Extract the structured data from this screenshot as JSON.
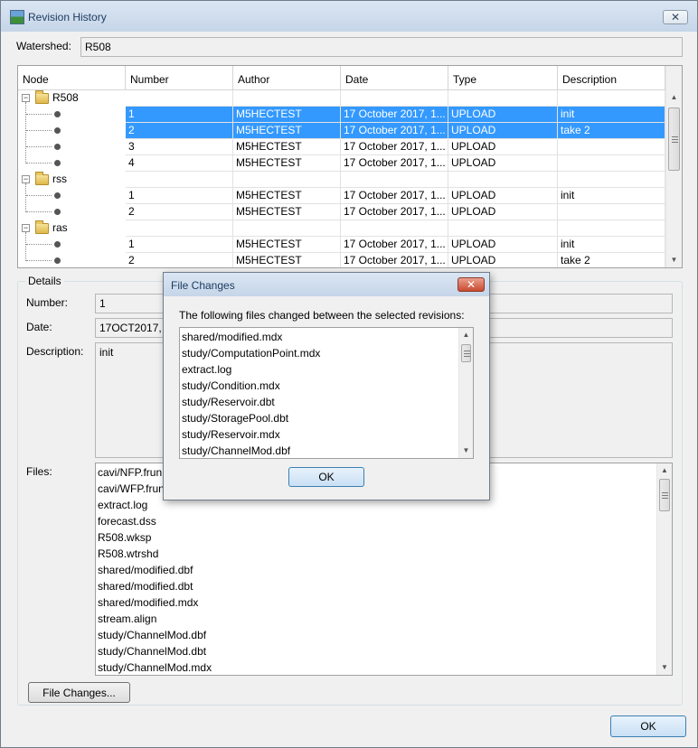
{
  "window": {
    "title": "Revision History",
    "close_symbol": "✕"
  },
  "watershed": {
    "label": "Watershed:",
    "value": "R508"
  },
  "table": {
    "columns": [
      "Node",
      "Number",
      "Author",
      "Date",
      "Type",
      "Description"
    ],
    "groups": [
      {
        "name": "R508",
        "expander": "−",
        "rows": [
          {
            "number": "1",
            "author": "M5HECTEST",
            "date": "17 October 2017, 1...",
            "type": "UPLOAD",
            "description": "init",
            "selected": true
          },
          {
            "number": "2",
            "author": "M5HECTEST",
            "date": "17 October 2017, 1...",
            "type": "UPLOAD",
            "description": "take 2",
            "selected": true
          },
          {
            "number": "3",
            "author": "M5HECTEST",
            "date": "17 October 2017, 1...",
            "type": "UPLOAD",
            "description": "",
            "selected": false
          },
          {
            "number": "4",
            "author": "M5HECTEST",
            "date": "17 October 2017, 1...",
            "type": "UPLOAD",
            "description": "",
            "selected": false
          }
        ]
      },
      {
        "name": "rss",
        "expander": "−",
        "rows": [
          {
            "number": "1",
            "author": "M5HECTEST",
            "date": "17 October 2017, 1...",
            "type": "UPLOAD",
            "description": "init",
            "selected": false
          },
          {
            "number": "2",
            "author": "M5HECTEST",
            "date": "17 October 2017, 1...",
            "type": "UPLOAD",
            "description": "",
            "selected": false
          }
        ]
      },
      {
        "name": "ras",
        "expander": "−",
        "rows": [
          {
            "number": "1",
            "author": "M5HECTEST",
            "date": "17 October 2017, 1...",
            "type": "UPLOAD",
            "description": "init",
            "selected": false
          },
          {
            "number": "2",
            "author": "M5HECTEST",
            "date": "17 October 2017, 1...",
            "type": "UPLOAD",
            "description": "take 2",
            "selected": false
          }
        ]
      }
    ]
  },
  "details": {
    "legend": "Details",
    "number": {
      "label": "Number:",
      "value": "1"
    },
    "date": {
      "label": "Date:",
      "value": "17OCT2017,"
    },
    "description": {
      "label": "Description:",
      "value": "init"
    },
    "files": {
      "label": "Files:",
      "items": [
        "cavi/NFP.frun",
        "cavi/WFP.frun",
        "extract.log",
        "forecast.dss",
        "R508.wksp",
        "R508.wtrshd",
        "shared/modified.dbf",
        "shared/modified.dbt",
        "shared/modified.mdx",
        "stream.align",
        "study/ChannelMod.dbf",
        "study/ChannelMod.dbt",
        "study/ChannelMod.mdx"
      ]
    },
    "file_changes_button": "File Changes..."
  },
  "ok_button": "OK",
  "dialog": {
    "title": "File Changes",
    "close_symbol": "✕",
    "message": "The following files changed between the selected revisions:",
    "files": [
      "shared/modified.mdx",
      "study/ComputationPoint.mdx",
      "extract.log",
      "study/Condition.mdx",
      "study/Reservoir.dbt",
      "study/StoragePool.dbt",
      "study/Reservoir.mdx",
      "study/ChannelMod.dbf"
    ],
    "ok_button": "OK"
  },
  "colors": {
    "selection": "#3399ff",
    "dialog_close": "#c94a30"
  },
  "icons": {
    "up": "▲",
    "down": "▼"
  }
}
